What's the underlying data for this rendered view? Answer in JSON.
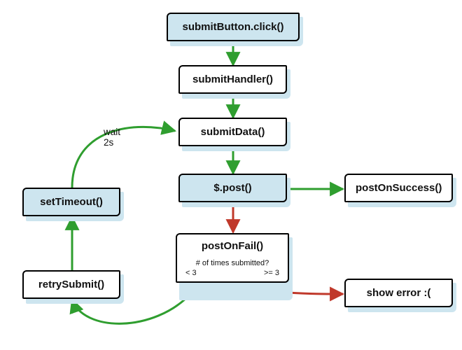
{
  "nodes": {
    "submitButtonClick": "submitButton.click()",
    "submitHandler": "submitHandler()",
    "submitData": "submitData()",
    "jqPost": "$.post()",
    "postOnSuccess": "postOnSuccess()",
    "postOnFail": "postOnFail()",
    "failQuestion": "# of times submitted?",
    "failBranchLt": "< 3",
    "failBranchGte": ">= 3",
    "showError": "show error :(",
    "retrySubmit": "retrySubmit()",
    "setTimeout": "setTimeout()"
  },
  "annotations": {
    "wait2s_line1": "wait",
    "wait2s_line2": "2s"
  },
  "colors": {
    "arrowGreen": "#2f9e2f",
    "arrowRed": "#c0392b",
    "nodeBlue": "#cde5ef",
    "ink": "#000000"
  },
  "chart_data": {
    "type": "flowchart",
    "nodes": [
      {
        "id": "submitButtonClick",
        "label": "submitButton.click()",
        "highlight": true
      },
      {
        "id": "submitHandler",
        "label": "submitHandler()"
      },
      {
        "id": "submitData",
        "label": "submitData()"
      },
      {
        "id": "jqPost",
        "label": "$.post()",
        "highlight": true
      },
      {
        "id": "postOnSuccess",
        "label": "postOnSuccess()"
      },
      {
        "id": "postOnFail",
        "label": "postOnFail()",
        "decision": "# of times submitted?",
        "branches": [
          "< 3",
          ">= 3"
        ]
      },
      {
        "id": "showError",
        "label": "show error :("
      },
      {
        "id": "retrySubmit",
        "label": "retrySubmit()"
      },
      {
        "id": "setTimeout",
        "label": "setTimeout()",
        "highlight": true
      }
    ],
    "edges": [
      {
        "from": "submitButtonClick",
        "to": "submitHandler",
        "kind": "success"
      },
      {
        "from": "submitHandler",
        "to": "submitData",
        "kind": "success"
      },
      {
        "from": "submitData",
        "to": "jqPost",
        "kind": "success"
      },
      {
        "from": "jqPost",
        "to": "postOnSuccess",
        "kind": "success"
      },
      {
        "from": "jqPost",
        "to": "postOnFail",
        "kind": "fail"
      },
      {
        "from": "postOnFail",
        "to": "showError",
        "kind": "fail",
        "condition": ">= 3"
      },
      {
        "from": "postOnFail",
        "to": "retrySubmit",
        "kind": "success",
        "condition": "< 3"
      },
      {
        "from": "retrySubmit",
        "to": "setTimeout",
        "kind": "success"
      },
      {
        "from": "setTimeout",
        "to": "submitData",
        "kind": "success",
        "label": "wait 2s"
      }
    ]
  }
}
